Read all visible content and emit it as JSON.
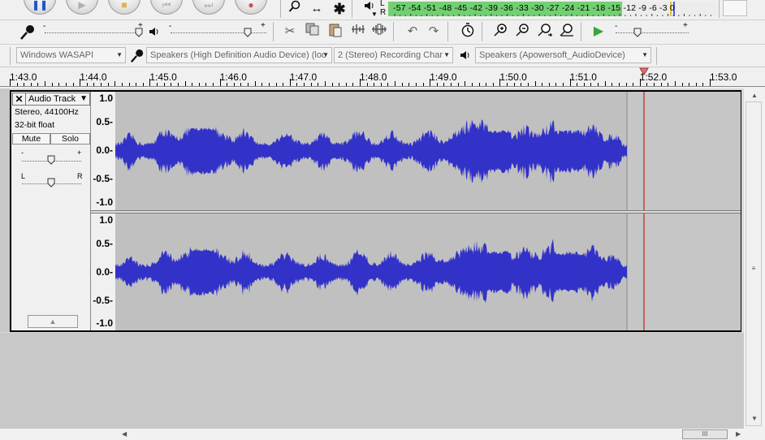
{
  "transport": {
    "pause": "❚❚",
    "play": "▶",
    "stop": "■",
    "skip_start": "⏮",
    "skip_end": "⏭",
    "record": "●"
  },
  "tools": {
    "zoom": "🔍",
    "timeshift": "↔",
    "multi": "✱"
  },
  "meter": {
    "ticks": "-57 -54 -51 -48 -45 -42 -39 -36 -33 -30 -27 -24 -21 -18 -15 -12  -9   -6  -3  0",
    "l_label": "L",
    "r_label": "R",
    "level": 0.71,
    "colors": {
      "level": "#72d072",
      "peak": "#e4c530",
      "max": "#4b5fd6"
    }
  },
  "mixer": {
    "minus": "-",
    "plus": "+"
  },
  "edit_icons": [
    "scissors-icon",
    "copy-icon",
    "paste-icon",
    "trim-icon",
    "silence-icon",
    "undo-icon",
    "redo-icon",
    "sync-lock-icon",
    "zoom-in-icon",
    "zoom-out-icon",
    "fit-selection-icon",
    "fit-project-icon",
    "play-at-speed-icon"
  ],
  "devices": {
    "host": "Windows WASAPI",
    "recording_device": "Speakers (High Definition Audio Device) (loo",
    "channels": "2 (Stereo) Recording Char",
    "playback_device": "Speakers (Apowersoft_AudioDevice)"
  },
  "ruler": {
    "labels": [
      "1:43.0",
      "1:44.0",
      "1:45.0",
      "1:46.0",
      "1:47.0",
      "1:48.0",
      "1:49.0",
      "1:50.0",
      "1:51.0",
      "1:52.0",
      "1:53.0"
    ]
  },
  "track": {
    "close": "✕",
    "name": "Audio Track",
    "menu_arrow": "▼",
    "format": "Stereo, 44100Hz",
    "bit_depth": "32-bit float",
    "mute": "Mute",
    "solo": "Solo",
    "gain_minus": "-",
    "gain_plus": "+",
    "pan_left": "L",
    "pan_right": "R",
    "collapse": "▲"
  },
  "vruler": {
    "labels": [
      "1.0",
      "0.5-",
      "0.0-",
      "-0.5-",
      "-1.0"
    ]
  },
  "waveform": {
    "color": "#3232c8",
    "clip_end_time": "1:51.6",
    "cursor_time": "1:51.8",
    "cursor_color": "#c00000"
  },
  "hscroll": {
    "thumb_grip": "III"
  }
}
